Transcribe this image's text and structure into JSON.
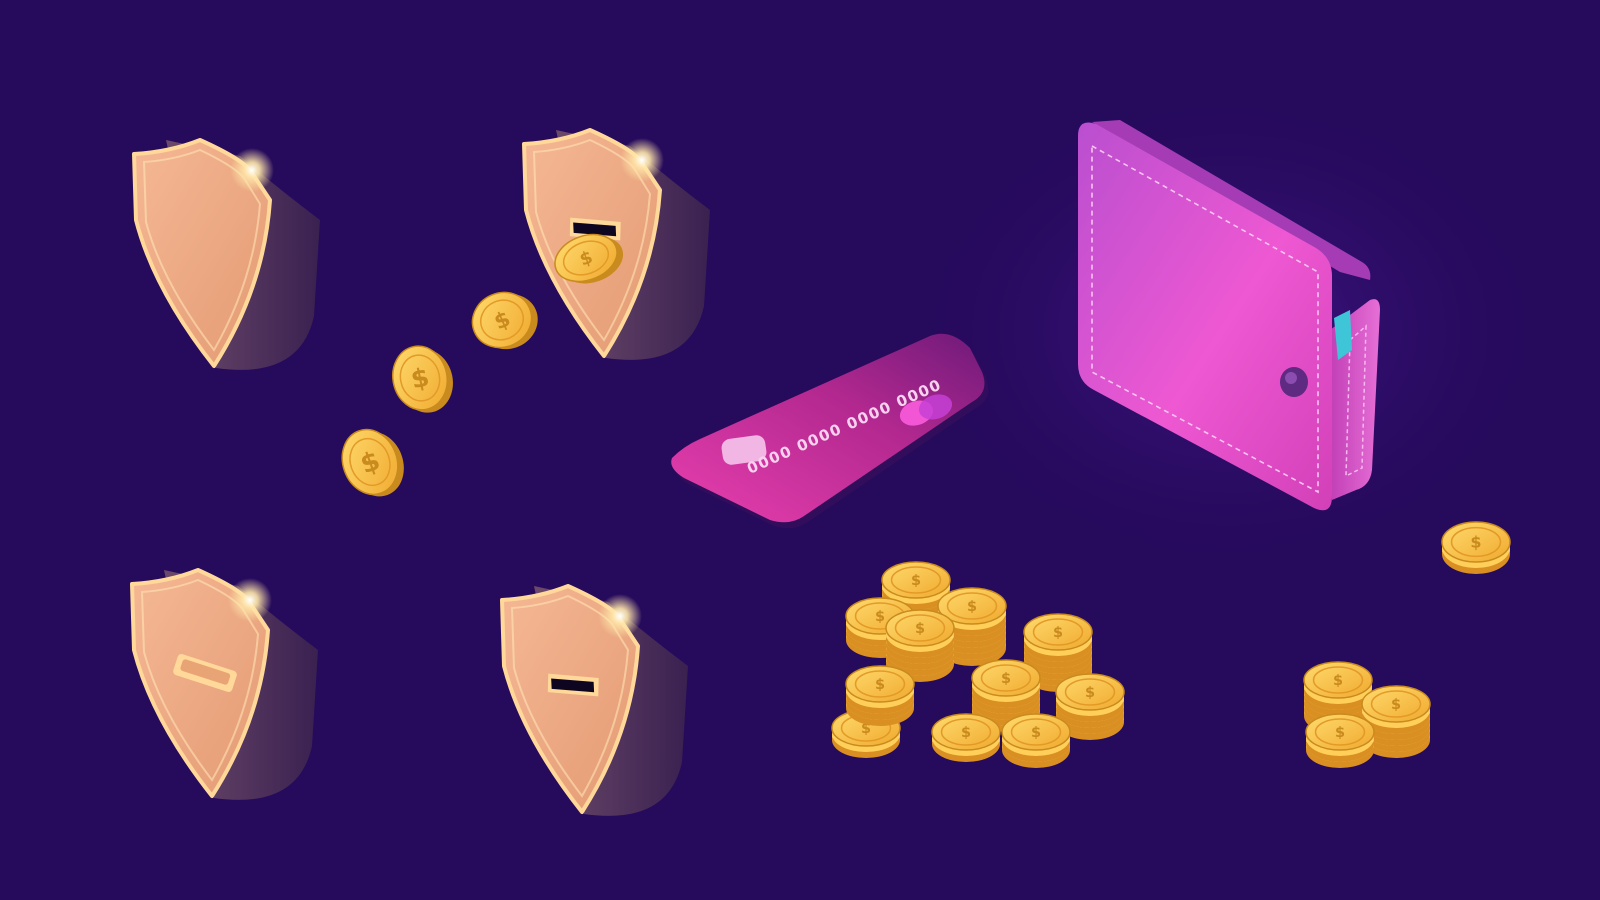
{
  "scene": {
    "title": "",
    "background_color": "#260a5c"
  },
  "colors": {
    "shield_face": "#eca882",
    "shield_rim": "#ffd89a",
    "shield_side": "#4d3159",
    "coin_gold": "#f2b83f",
    "coin_dark": "#c98a1e",
    "card_magenta": "#d0319e",
    "wallet_pink": "#e24fc9"
  },
  "shields": [
    {
      "name": "shield-plain",
      "slot": "none"
    },
    {
      "name": "shield-coin-inserting",
      "slot": "open"
    },
    {
      "name": "shield-slot-closed",
      "slot": "closed"
    },
    {
      "name": "shield-slot-open",
      "slot": "open"
    }
  ],
  "credit_card": {
    "number": "0000 0000 0000 0000",
    "brand_icon": "mastercard-circles-icon",
    "chip_icon": "chip-icon"
  },
  "wallet": {
    "icon": "wallet-icon",
    "contains_card": true
  },
  "coins": {
    "symbol": "$",
    "flying_count": 4,
    "large_stack_count": 6,
    "small_stack_count": 3,
    "loose_count": 1
  }
}
